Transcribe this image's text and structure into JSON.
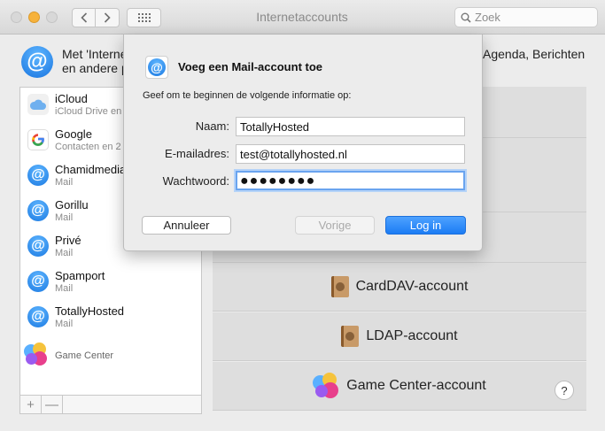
{
  "window": {
    "title": "Internetaccounts"
  },
  "search": {
    "placeholder": "Zoek"
  },
  "header": {
    "line1": "Met 'Interne",
    "line2": "en andere p",
    "right_text": "Agenda, Berichten"
  },
  "accounts": [
    {
      "name": "iCloud",
      "sub": "iCloud Drive en",
      "icon": "icloud-icon"
    },
    {
      "name": "Google",
      "sub": "Contacten en 2",
      "icon": "google-icon"
    },
    {
      "name": "Chamidmedia",
      "sub": "Mail",
      "icon": "mail-icon"
    },
    {
      "name": "Gorillu",
      "sub": "Mail",
      "icon": "mail-icon"
    },
    {
      "name": "Privé",
      "sub": "Mail",
      "icon": "mail-icon"
    },
    {
      "name": "Spamport",
      "sub": "Mail",
      "icon": "mail-icon"
    },
    {
      "name": "TotallyHosted",
      "sub": "Mail",
      "icon": "mail-icon"
    },
    {
      "name": "Game Center",
      "sub": "",
      "icon": "game-center-icon"
    }
  ],
  "list_controls": {
    "add": "+",
    "remove": "—"
  },
  "providers": [
    {
      "label": "CardDAV-account",
      "icon": "contacts-book-icon"
    },
    {
      "label": "LDAP-account",
      "icon": "contacts-book-icon"
    },
    {
      "label": "Game Center-account",
      "icon": "game-center-icon"
    }
  ],
  "help": "?",
  "sheet": {
    "title": "Voeg een Mail-account toe",
    "intro": "Geef om te beginnen de volgende informatie op:",
    "name_label": "Naam:",
    "name_value": "TotallyHosted",
    "email_label": "E-mailadres:",
    "email_value": "test@totallyhosted.nl",
    "password_label": "Wachtwoord:",
    "password_value": "●●●●●●●●",
    "cancel": "Annuleer",
    "previous": "Vorige",
    "login": "Log in"
  },
  "colors": {
    "accent": "#1b7cf4",
    "focus_ring": "#6aa4ef",
    "minimize": "#f6b23c"
  }
}
